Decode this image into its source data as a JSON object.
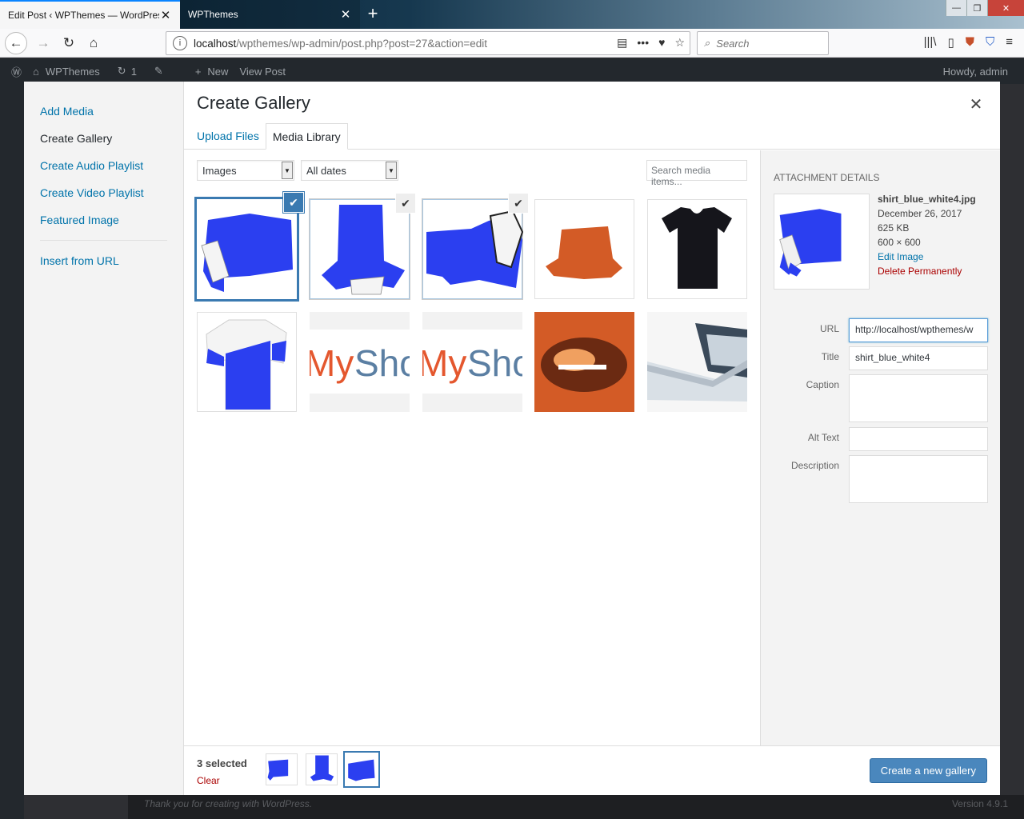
{
  "browser": {
    "tabs": [
      {
        "title": "Edit Post ‹ WPThemes — WordPress",
        "close": "✕"
      },
      {
        "title": "WPThemes",
        "close": "✕"
      }
    ],
    "new_tab": "+",
    "url_host": "localhost",
    "url_path": "/wpthemes/wp-admin/post.php?post=27&action=edit",
    "search_placeholder": "Search",
    "window_controls": [
      "—",
      "❐",
      "✕"
    ]
  },
  "wp_admin_bar": {
    "site": "WPThemes",
    "updates": "1",
    "new": "New",
    "view_post": "View Post",
    "howdy": "Howdy, admin"
  },
  "wp_footer": {
    "thanks": "Thank you for creating with WordPress.",
    "version": "Version 4.9.1"
  },
  "media_modal": {
    "menu": [
      {
        "label": "Add Media",
        "active": false
      },
      {
        "label": "Create Gallery",
        "active": true
      },
      {
        "label": "Create Audio Playlist",
        "active": false
      },
      {
        "label": "Create Video Playlist",
        "active": false
      },
      {
        "label": "Featured Image",
        "active": false
      },
      {
        "label": "Insert from URL",
        "active": false
      }
    ],
    "title": "Create Gallery",
    "close": "✕",
    "tabs": {
      "upload": "Upload Files",
      "library": "Media Library"
    },
    "filters": {
      "type": "Images",
      "dates": "All dates",
      "search_placeholder": "Search media items..."
    },
    "tiles": [
      {
        "name": "shirt-blue-white-4",
        "kind": "shirt-side",
        "selected": true,
        "focused": true,
        "color": "#2b3ff0"
      },
      {
        "name": "shirt-blue-white-3",
        "kind": "shirt-down",
        "selected": true,
        "focused": false,
        "color": "#2b3ff0"
      },
      {
        "name": "shirt-blue-white-2",
        "kind": "shirt-side-r",
        "selected": true,
        "focused": false,
        "color": "#2b3ff0"
      },
      {
        "name": "orange-hat",
        "kind": "hat",
        "selected": false,
        "focused": false,
        "color": "#d35b26"
      },
      {
        "name": "black-tshirt",
        "kind": "tee",
        "selected": false,
        "focused": false,
        "color": "#15151b"
      },
      {
        "name": "shirt-blue-white",
        "kind": "shirt-front",
        "selected": false,
        "focused": false,
        "color": "#2b3ff0"
      },
      {
        "name": "myshop-logo-1",
        "kind": "logo",
        "selected": false,
        "focused": false,
        "color": "#e4572e"
      },
      {
        "name": "myshop-logo-2",
        "kind": "logo",
        "selected": false,
        "focused": false,
        "color": "#e4572e"
      },
      {
        "name": "orange-photo",
        "kind": "photo",
        "selected": false,
        "focused": false,
        "color": "#d35b26"
      },
      {
        "name": "laptop",
        "kind": "laptop",
        "selected": false,
        "focused": false,
        "color": "#c9d3dc"
      }
    ],
    "attachment": {
      "heading": "Attachment Details",
      "filename": "shirt_blue_white4.jpg",
      "date": "December 26, 2017",
      "size": "625 KB",
      "dimensions": "600 × 600",
      "edit": "Edit Image",
      "delete": "Delete Permanently",
      "fields": {
        "url_label": "URL",
        "url_value": "http://localhost/wpthemes/w",
        "title_label": "Title",
        "title_value": "shirt_blue_white4",
        "caption_label": "Caption",
        "alt_label": "Alt Text",
        "description_label": "Description"
      }
    },
    "footer": {
      "selected_count": "3 selected",
      "clear": "Clear",
      "button": "Create a new gallery"
    }
  },
  "colors": {
    "accent": "#0073aa",
    "primary_button": "#4a87bd",
    "focus": "#3a7ab1",
    "danger": "#a00",
    "shirt_blue": "#2b3ff0"
  }
}
